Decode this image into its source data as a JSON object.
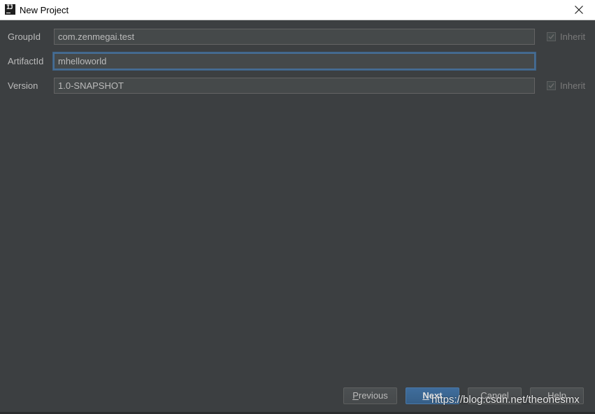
{
  "window": {
    "title": "New Project",
    "app_icon_glyph": "IJ",
    "icon": "intellij-app-icon"
  },
  "form": {
    "group_id": {
      "label": "GroupId",
      "value": "com.zenmegai.test",
      "inherit_label": "Inherit",
      "inherit_checked": true
    },
    "artifact_id": {
      "label": "ArtifactId",
      "value": "mhelloworld"
    },
    "version": {
      "label": "Version",
      "value": "1.0-SNAPSHOT",
      "inherit_label": "Inherit",
      "inherit_checked": true
    }
  },
  "buttons": {
    "previous": {
      "mnemonic": "P",
      "rest": "revious"
    },
    "next": {
      "mnemonic": "N",
      "rest": "ext"
    },
    "cancel": "Cancel",
    "help": "Help"
  },
  "watermark": "https://blog.csdn.net/theonesmx",
  "colors": {
    "background": "#3c3f41",
    "field_bg": "#45494a",
    "focus_border": "#466d94",
    "primary_button": "#365f88",
    "label_text": "#bbbbbb"
  }
}
